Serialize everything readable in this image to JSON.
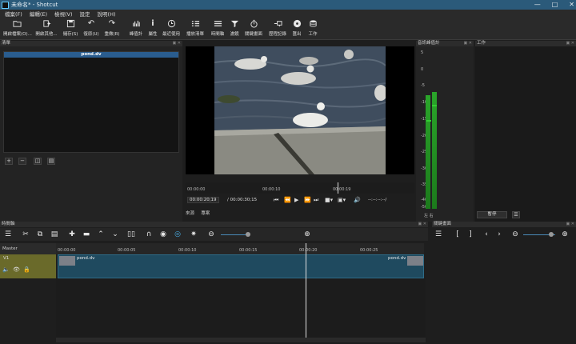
{
  "window": {
    "title": "未命名* - Shotcut"
  },
  "menu": [
    "檔案(F)",
    "編輯(E)",
    "檢視(V)",
    "設定",
    "說明(H)"
  ],
  "toolbar": [
    {
      "label": "開啟檔案(O)...",
      "icon": "folder-icon"
    },
    {
      "label": "開啟其他...",
      "icon": "open-other-icon"
    },
    {
      "label": "儲存(S)",
      "icon": "save-icon"
    },
    {
      "label": "復原(U)",
      "icon": "undo-icon"
    },
    {
      "label": "重做(R)",
      "icon": "redo-icon"
    },
    {
      "label": "峰值計",
      "icon": "peak-meter-icon"
    },
    {
      "label": "屬性",
      "icon": "info-icon"
    },
    {
      "label": "最近使用",
      "icon": "clock-icon"
    },
    {
      "label": "播放清單",
      "icon": "list-icon"
    },
    {
      "label": "時間軸",
      "icon": "timeline-icon"
    },
    {
      "label": "濾鏡",
      "icon": "filter-icon"
    },
    {
      "label": "關鍵畫面",
      "icon": "stopwatch-icon"
    },
    {
      "label": "歷程記錄",
      "icon": "history-icon"
    },
    {
      "label": "匯出",
      "icon": "export-icon"
    },
    {
      "label": "工作",
      "icon": "jobs-icon"
    }
  ],
  "playlist": {
    "title": "清單",
    "header": "pond.dv"
  },
  "player": {
    "position": "00:00:20;19",
    "duration": "/ 00:00:30;15",
    "in_out": "--:--:--:--/",
    "ruler": [
      "00:00:00",
      "00:00:10",
      "00:00:19"
    ],
    "tabs": [
      "來源",
      "專案"
    ]
  },
  "meter": {
    "title": "音訊峰值計",
    "scale": [
      "5",
      "0",
      "-5",
      "-10",
      "-15",
      "-20",
      "-25",
      "-30",
      "-35",
      "-40",
      "-50"
    ],
    "channels": "左 右",
    "levels": [
      0.71,
      0.73
    ]
  },
  "jobs": {
    "title": "工作",
    "pause": "暫停"
  },
  "timeline": {
    "title": "時間軸",
    "master": "Master",
    "track": "V1",
    "clip_name": "pond.dv",
    "clip_name_end": "pond.dv",
    "ruler": [
      "00:00:00",
      "00:00:05",
      "00:00:10",
      "00:00:15",
      "00:00:20",
      "00:00:25"
    ]
  },
  "keyframes": {
    "title": "關鍵畫面"
  }
}
